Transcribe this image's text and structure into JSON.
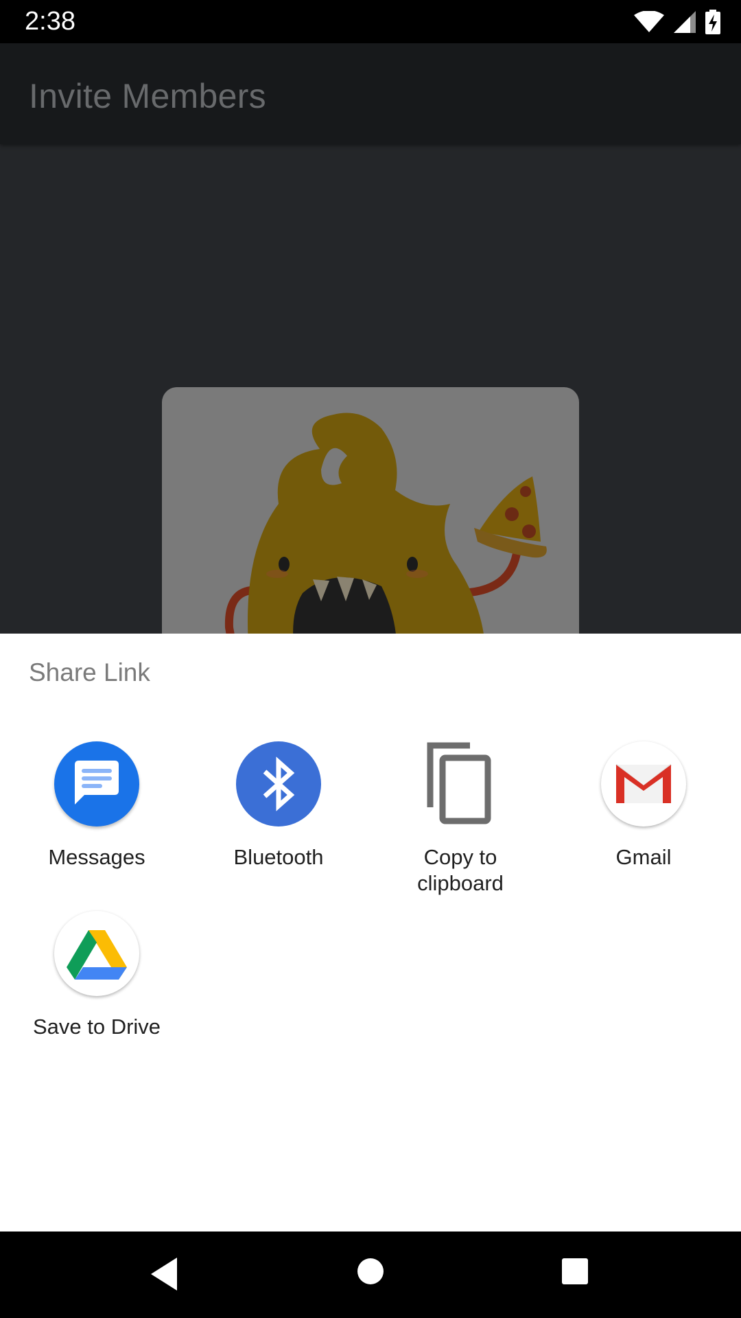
{
  "status_bar": {
    "time": "2:38",
    "icons": [
      "wifi-icon",
      "cell-signal-icon",
      "battery-charging-icon"
    ]
  },
  "app": {
    "title": "Invite Members"
  },
  "share_sheet": {
    "title": "Share Link",
    "targets": [
      {
        "label": "Messages",
        "icon": "messages-icon",
        "color": "#1a73e8"
      },
      {
        "label": "Bluetooth",
        "icon": "bluetooth-icon",
        "color": "#3b6fd6"
      },
      {
        "label": "Copy to\nclipboard",
        "icon": "copy-icon",
        "color": "#6d6d6d"
      },
      {
        "label": "Gmail",
        "icon": "gmail-icon",
        "color": "#d93025"
      },
      {
        "label": "Save to Drive",
        "icon": "google-drive-icon",
        "color": "#34a853"
      }
    ]
  },
  "nav_bar": {
    "buttons": [
      "back-icon",
      "home-icon",
      "recents-icon"
    ]
  }
}
